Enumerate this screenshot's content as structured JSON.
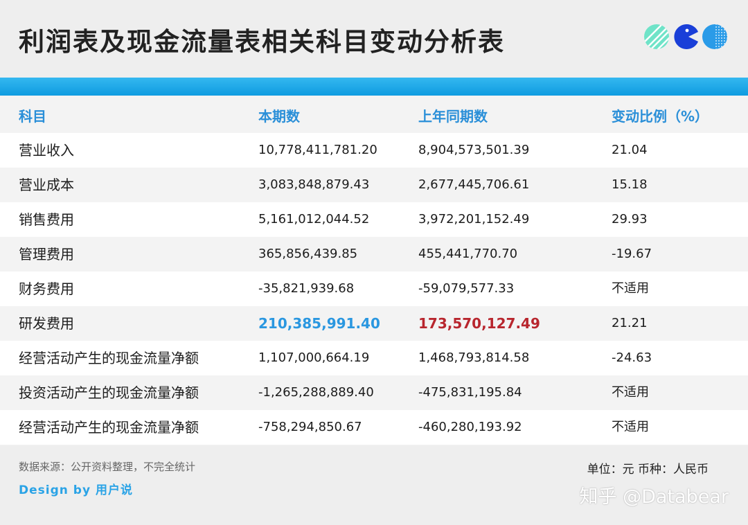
{
  "title": "利润表及现金流量表相关科目变动分析表",
  "logo": {
    "icons": [
      "striped-circle-icon",
      "pacman-icon",
      "dotted-circle-icon"
    ]
  },
  "colors": {
    "accent_blue": "#2a97e0",
    "accent_red": "#b8262e",
    "band": "#1aa7ea"
  },
  "table": {
    "headers": [
      "科目",
      "本期数",
      "上年同期数",
      "变动比例（%）"
    ],
    "rows": [
      {
        "item": "营业收入",
        "current": "10,778,411,781.20",
        "previous": "8,904,573,501.39",
        "change": "21.04"
      },
      {
        "item": "营业成本",
        "current": "3,083,848,879.43",
        "previous": "2,677,445,706.61",
        "change": "15.18"
      },
      {
        "item": "销售费用",
        "current": "5,161,012,044.52",
        "previous": "3,972,201,152.49",
        "change": "29.93"
      },
      {
        "item": "管理费用",
        "current": "365,856,439.85",
        "previous": "455,441,770.70",
        "change": "-19.67"
      },
      {
        "item": "财务费用",
        "current": "-35,821,939.68",
        "previous": "-59,079,577.33",
        "change": "不适用"
      },
      {
        "item": "研发费用",
        "current": "210,385,991.40",
        "previous": "173,570,127.49",
        "change": "21.21"
      },
      {
        "item": "经营活动产生的现金流量净额",
        "current": "1,107,000,664.19",
        "previous": "1,468,793,814.58",
        "change": "-24.63"
      },
      {
        "item": "投资活动产生的现金流量净额",
        "current": "-1,265,288,889.40",
        "previous": "-475,831,195.84",
        "change": "不适用"
      },
      {
        "item": "经营活动产生的现金流量净额",
        "current": "-758,294,850.67",
        "previous": "-460,280,193.92",
        "change": "不适用"
      }
    ]
  },
  "footer": {
    "source": "数据来源：公开资料整理，不完全统计",
    "design": "Design by 用户说",
    "unit": "单位：元 币种：人民币",
    "watermark": "知乎 @Databear"
  }
}
